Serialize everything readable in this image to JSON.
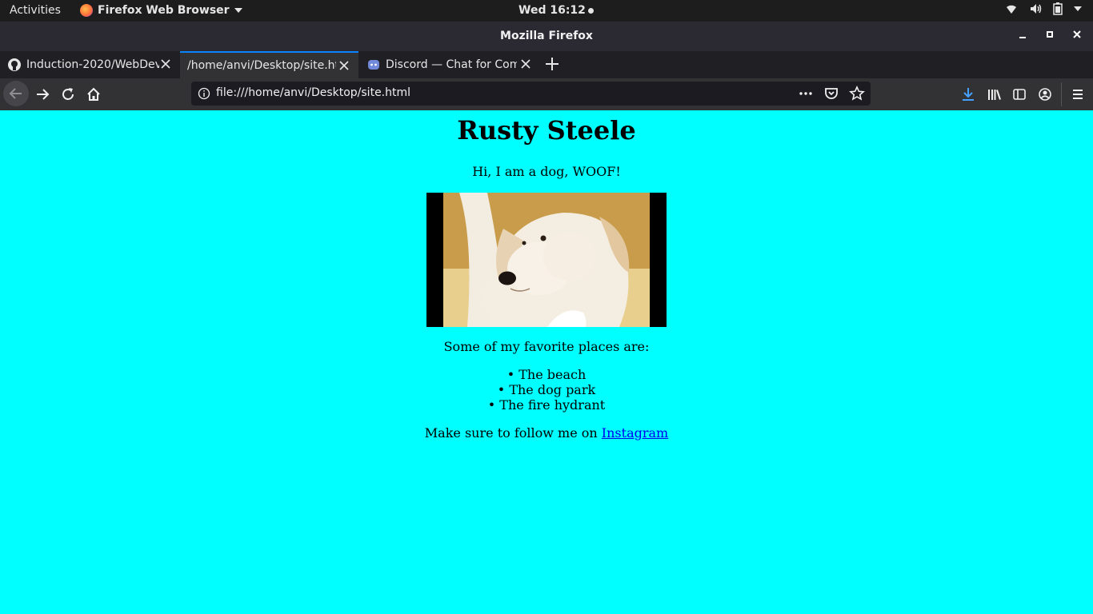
{
  "system_bar": {
    "activities": "Activities",
    "app_name": "Firefox Web Browser",
    "clock": "Wed 16:12"
  },
  "window": {
    "title": "Mozilla Firefox"
  },
  "tabs": [
    {
      "label": "Induction-2020/WebDev",
      "favicon": "github-icon",
      "active": false
    },
    {
      "label": "/home/anvi/Desktop/site.ht",
      "favicon": "none",
      "active": true
    },
    {
      "label": "Discord — Chat for Com",
      "favicon": "discord-icon",
      "active": false
    }
  ],
  "navbar": {
    "url": "file:///home/anvi/Desktop/site.html"
  },
  "page": {
    "heading": "Rusty Steele",
    "intro": "Hi, I am a dog, WOOF!",
    "places_intro": "Some of my favorite places are:",
    "places": [
      "The beach",
      "The dog park",
      "The fire hydrant"
    ],
    "follow_text": "Make sure to follow me on ",
    "follow_link": "Instagram",
    "background": "#00ffff",
    "link_color": "#0000ee"
  }
}
